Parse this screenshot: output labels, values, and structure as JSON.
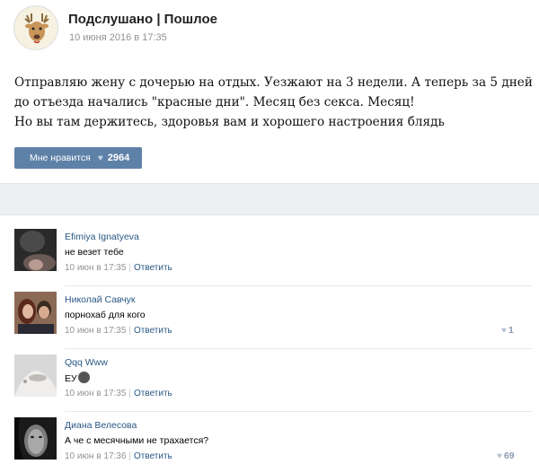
{
  "post": {
    "group_name": "Подслушано | Пошлое",
    "date": "10 июня 2016 в 17:35",
    "text_lines": [
      "Отправляю жену с дочерью на отдых. Уезжают на 3 недели. А теперь за 5 дней",
      "до отъезда начались \"красные дни\". Месяц без секса. Месяц!",
      "Но вы там держитесь, здоровья вам и хорошего настроения блядь"
    ],
    "like_label": "Мне нравится",
    "like_count": "2964"
  },
  "comments": [
    {
      "author": "Efimiya Ignatyeva",
      "text": "не везет тебе",
      "time": "10 июн в 17:35",
      "reply": "Ответить",
      "likes": ""
    },
    {
      "author": "Николай Савчук",
      "text": "порнохаб для кого",
      "time": "10 июн в 17:35",
      "reply": "Ответить",
      "likes": "1"
    },
    {
      "author": "Qqq Www",
      "text": "ЕУ",
      "time": "10 июн в 17:35",
      "reply": "Ответить",
      "likes": ""
    },
    {
      "author": "Диана Велесова",
      "text": "А че с месячными не трахается?",
      "time": "10 июн в 17:36",
      "reply": "Ответить",
      "likes": "69"
    }
  ],
  "colors": {
    "accent": "#5e81a8",
    "link": "#2a5885",
    "muted": "#939393",
    "band": "#edeef0"
  },
  "icons": {
    "like": "heart-icon"
  }
}
